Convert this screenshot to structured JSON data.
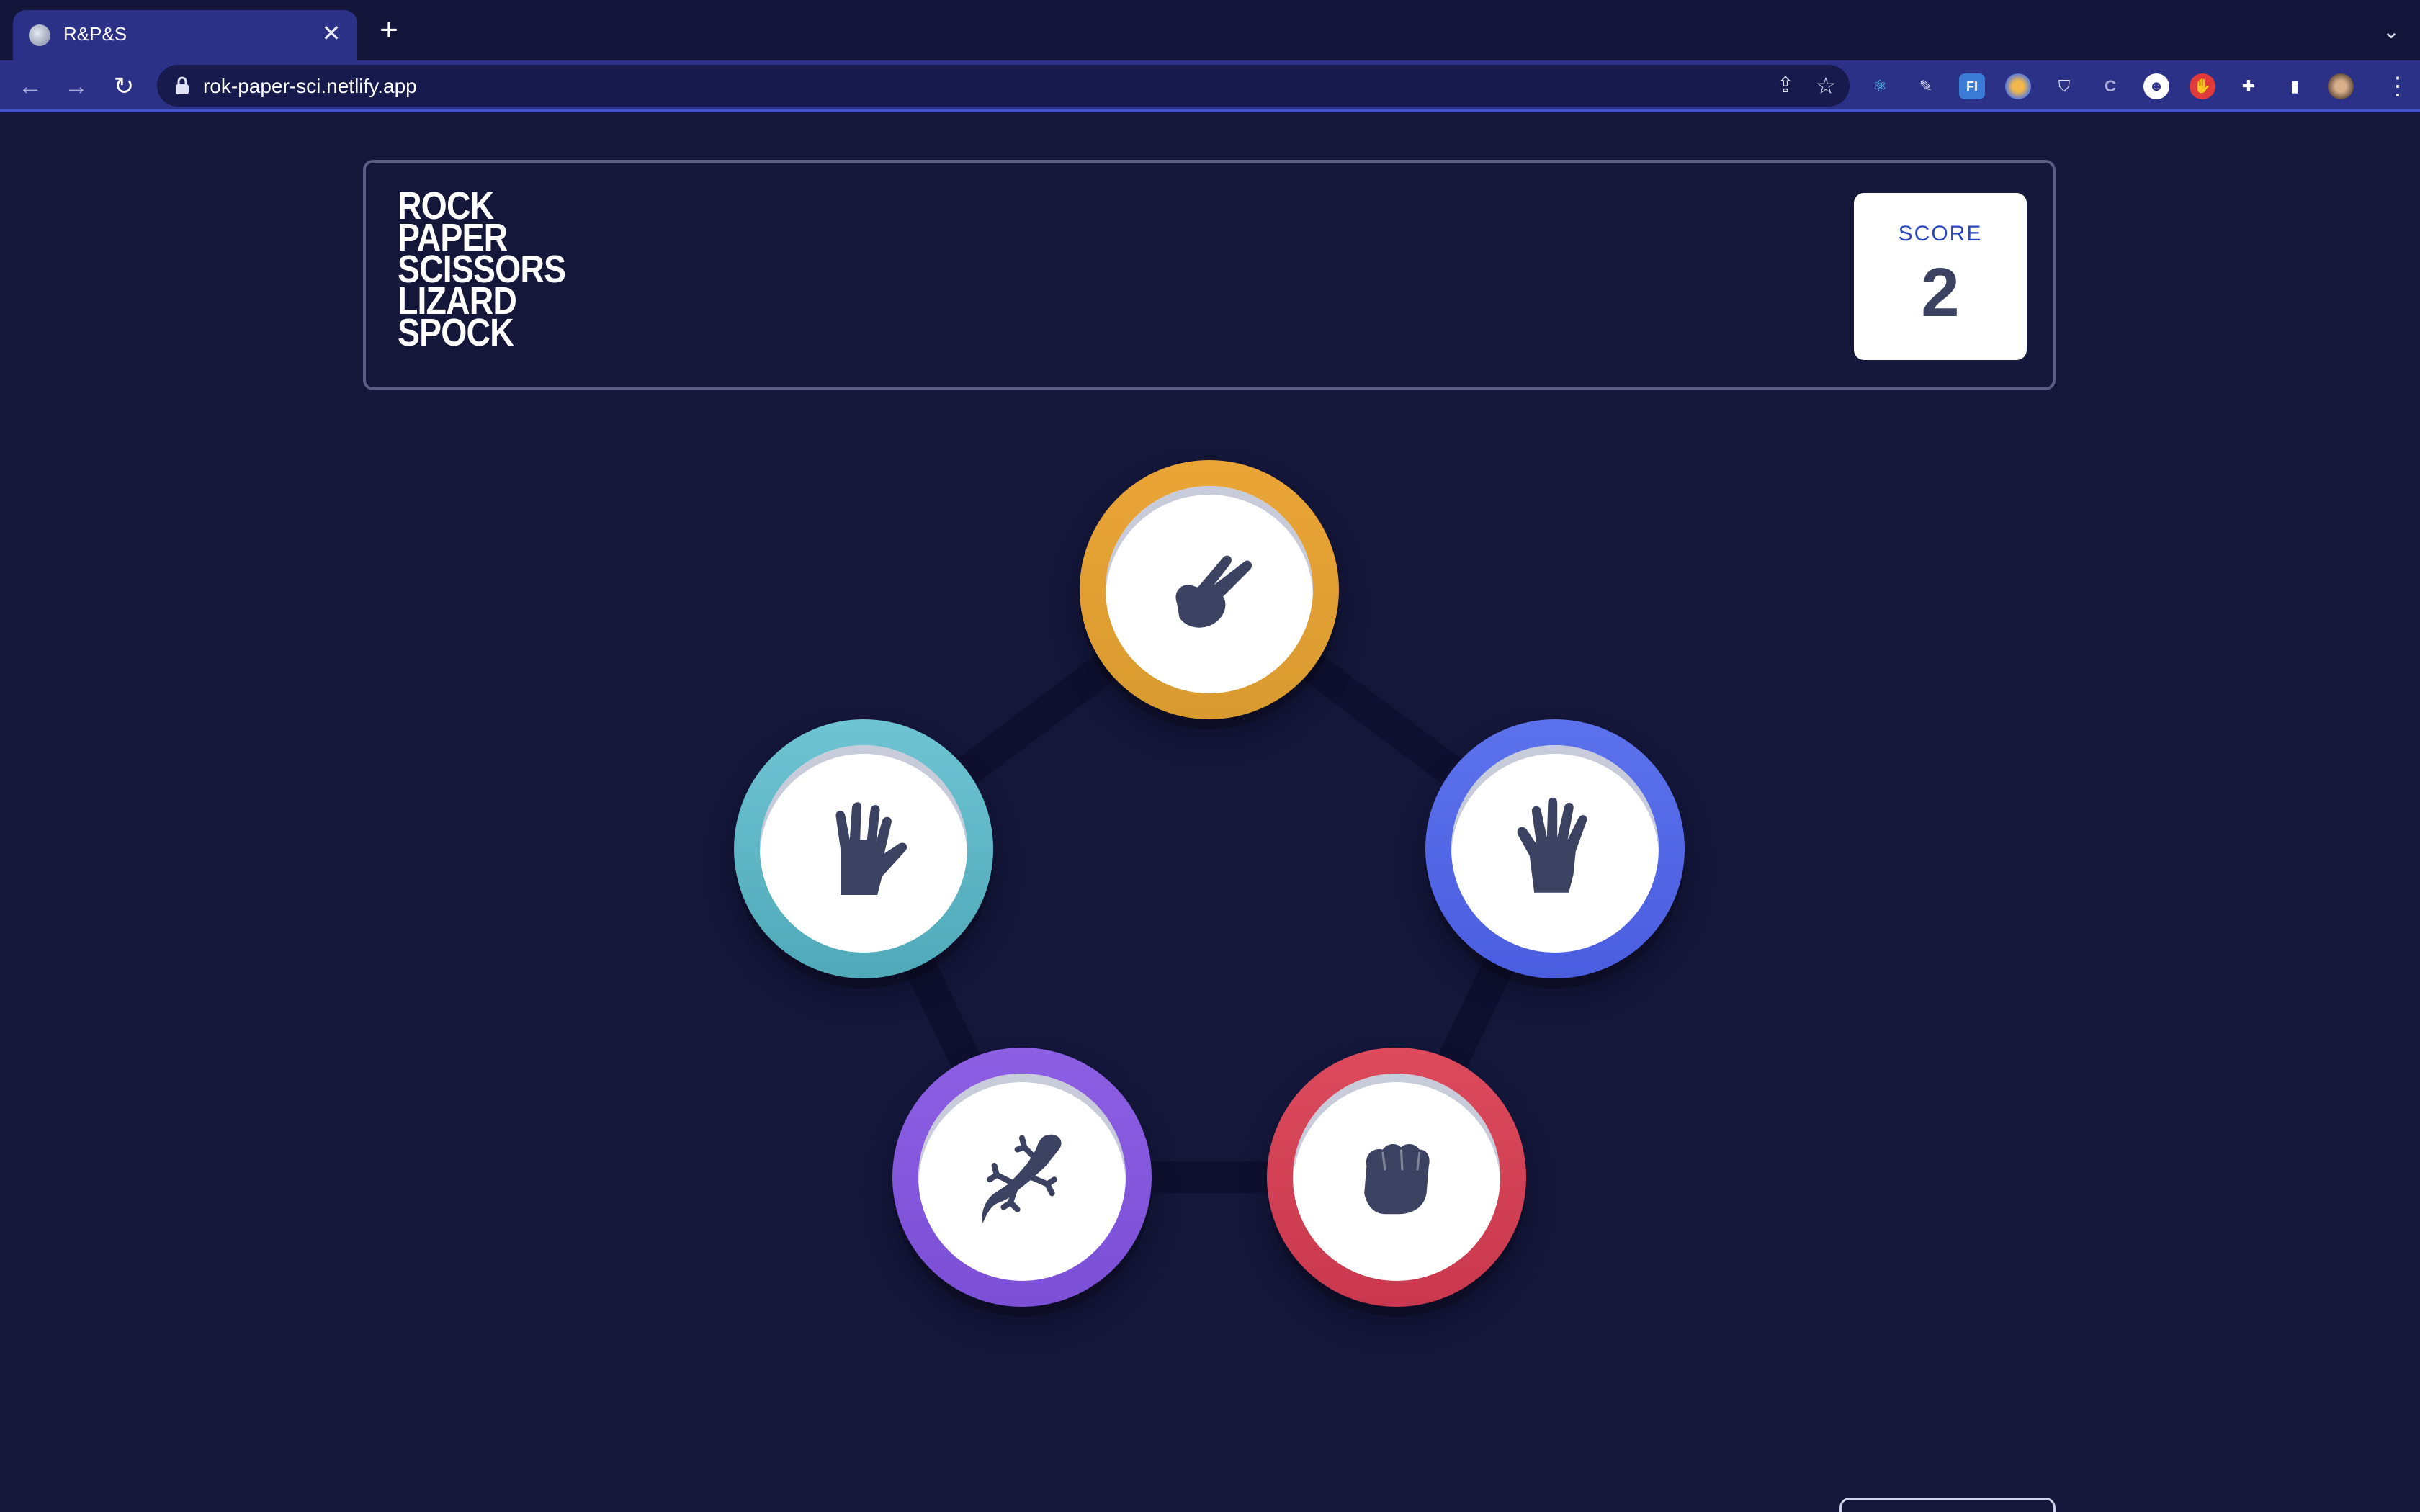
{
  "browser": {
    "tab": {
      "title": "R&P&S"
    },
    "url": "rok-paper-sci.netlify.app"
  },
  "game": {
    "logo_lines": [
      "ROCK",
      "PAPER",
      "SCISSORS",
      "LIZARD",
      "SPOCK"
    ],
    "score": {
      "label": "SCORE",
      "value": "2"
    },
    "choices": [
      {
        "id": "scissors",
        "label": "Scissors",
        "color": "#eba537",
        "icon": "scissors-hand-icon"
      },
      {
        "id": "spock",
        "label": "Spock",
        "color": "#5fb9c8",
        "icon": "spock-hand-icon"
      },
      {
        "id": "paper",
        "label": "Paper",
        "color": "#5366ea",
        "icon": "paper-hand-icon"
      },
      {
        "id": "lizard",
        "label": "Lizard",
        "color": "#8456dd",
        "icon": "lizard-icon"
      },
      {
        "id": "rock",
        "label": "Rock",
        "color": "#d34257",
        "icon": "rock-fist-icon"
      }
    ],
    "background_color": "#14163a",
    "pentagon_color": "#0f1030"
  }
}
